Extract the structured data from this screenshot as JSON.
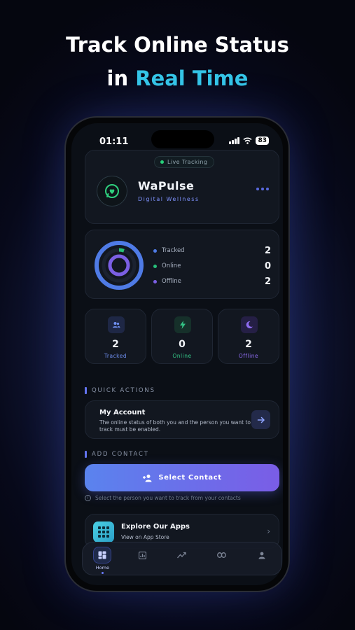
{
  "promo": {
    "line1": "Track Online Status",
    "line2_prefix": "in",
    "line2_accent": "Real Time"
  },
  "status_bar": {
    "time": "01:11",
    "battery": "83"
  },
  "header": {
    "live_label": "Live Tracking",
    "app_name": "WaPulse",
    "app_subtitle": "Digital Wellness"
  },
  "stats": {
    "rows": [
      {
        "label": "Tracked",
        "value": "2",
        "color": "#4f7be6"
      },
      {
        "label": "Online",
        "value": "0",
        "color": "#27c07a"
      },
      {
        "label": "Offline",
        "value": "2",
        "color": "#7b5fe4"
      }
    ]
  },
  "tiles": [
    {
      "value": "2",
      "label": "Tracked",
      "color": "#6f8ff0",
      "icon": "users-icon"
    },
    {
      "value": "0",
      "label": "Online",
      "color": "#33c485",
      "icon": "bolt-icon"
    },
    {
      "value": "2",
      "label": "Offline",
      "color": "#8e6cf0",
      "icon": "moon-icon"
    }
  ],
  "quick_actions": {
    "section_title": "QUICK ACTIONS",
    "account_title": "My Account",
    "account_desc": "The online status of both you and the person you want to track must be enabled."
  },
  "add_contact": {
    "section_title": "ADD CONTACT",
    "button_label": "Select Contact",
    "hint": "Select the person you want to track from your contacts"
  },
  "explore": {
    "title": "Explore Our Apps",
    "subtitle": "View on App Store"
  },
  "tabbar": {
    "tabs": [
      {
        "label": "Home",
        "icon": "dashboard-icon",
        "active": true
      },
      {
        "label": "",
        "icon": "chart-icon",
        "active": false
      },
      {
        "label": "",
        "icon": "trend-icon",
        "active": false
      },
      {
        "label": "",
        "icon": "link-icon",
        "active": false
      },
      {
        "label": "",
        "icon": "profile-icon",
        "active": false
      }
    ]
  }
}
